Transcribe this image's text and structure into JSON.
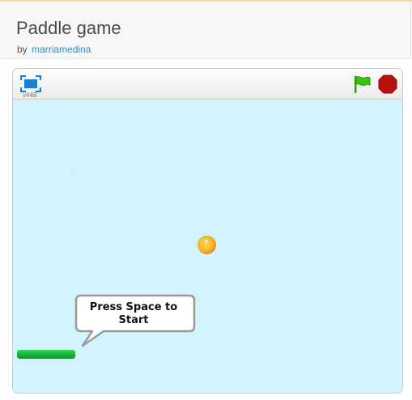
{
  "project": {
    "title": "Paddle game",
    "by_label": "by",
    "author": "marriamedina"
  },
  "player": {
    "version": "v448",
    "controls": {
      "fullscreen_icon": "fullscreen-icon",
      "flag_icon": "green-flag-icon",
      "stop_icon": "stop-sign-icon"
    }
  },
  "stage": {
    "background": "#d2f4fd",
    "speech_bubble": "Press Space to Start",
    "sprites": [
      "ball",
      "paddle"
    ]
  },
  "colors": {
    "accent_link": "#2f8ecb",
    "flag_green": "#3bc40f",
    "stop_red": "#b8100f",
    "fullscreen_blue": "#1a7fd1"
  }
}
